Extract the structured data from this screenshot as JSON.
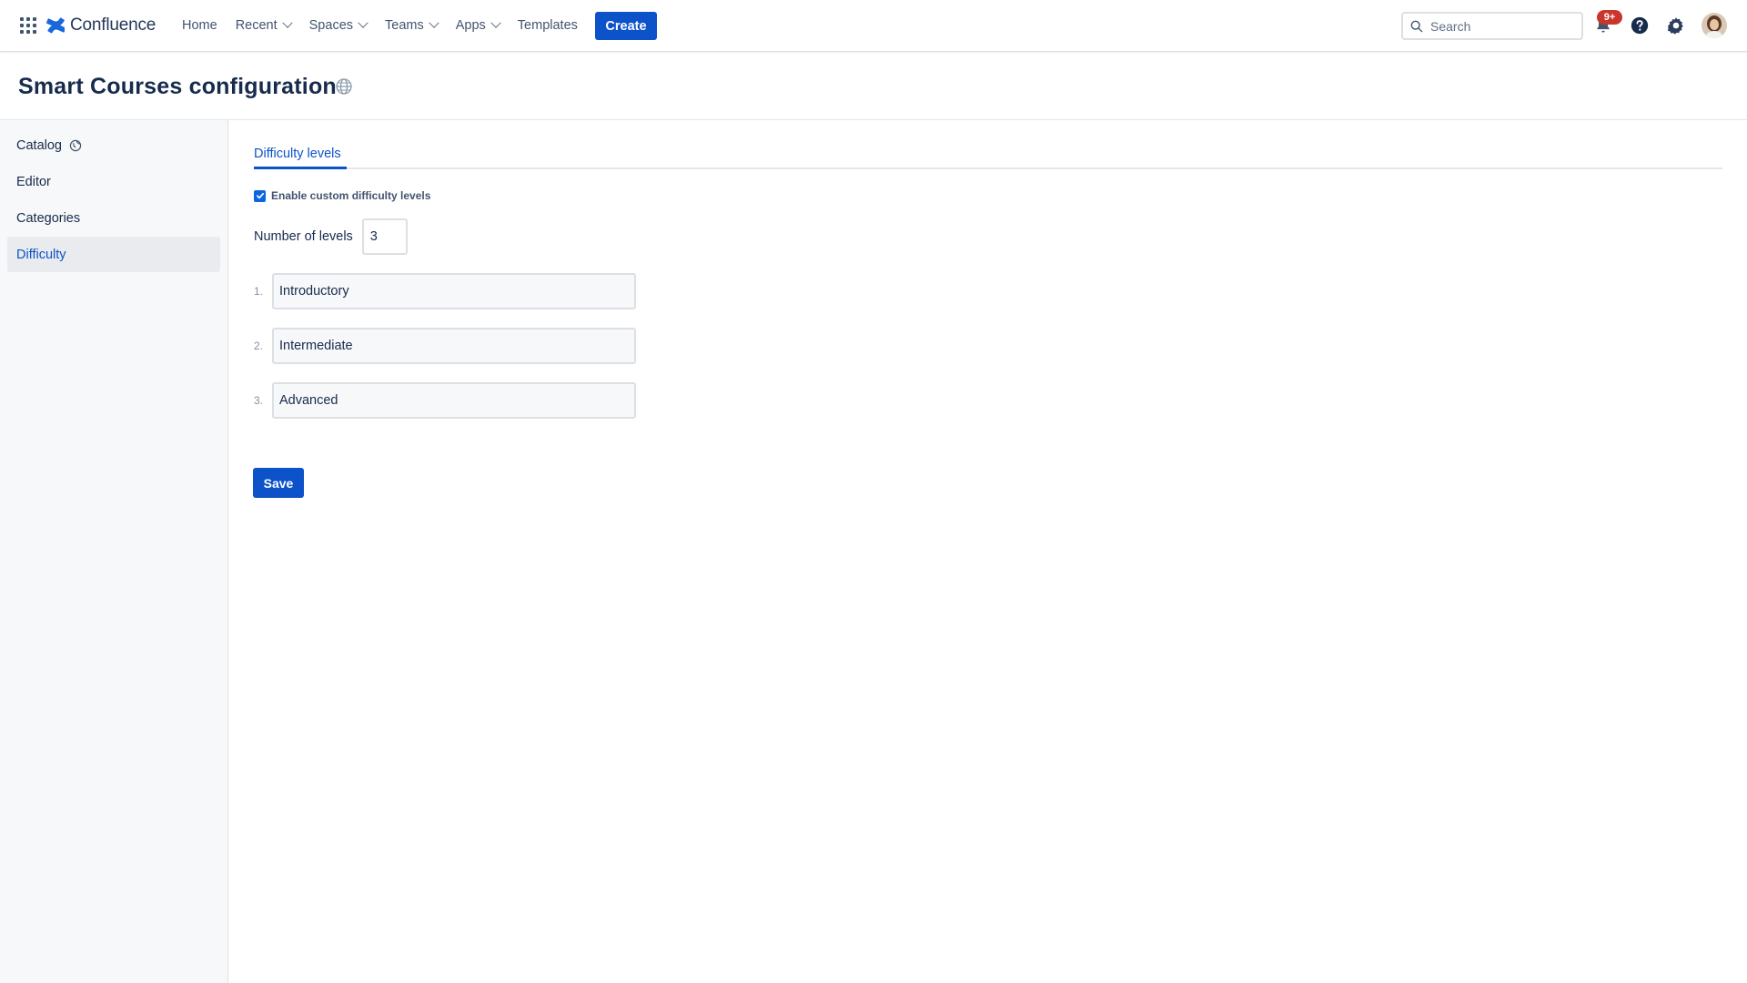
{
  "app": {
    "name": "Confluence"
  },
  "nav": {
    "items": [
      {
        "label": "Home",
        "dropdown": false
      },
      {
        "label": "Recent",
        "dropdown": true
      },
      {
        "label": "Spaces",
        "dropdown": true
      },
      {
        "label": "Teams",
        "dropdown": true
      },
      {
        "label": "Apps",
        "dropdown": true
      },
      {
        "label": "Templates",
        "dropdown": false
      }
    ],
    "create_label": "Create",
    "search_placeholder": "Search",
    "notifications_badge": "9+",
    "accent_color": "#0c52c9",
    "badge_color": "#c9372c"
  },
  "page": {
    "title": "Smart Courses configuration"
  },
  "sidebar": {
    "items": [
      {
        "label": "Catalog",
        "icon": "globe-icon",
        "active": false
      },
      {
        "label": "Editor",
        "active": false
      },
      {
        "label": "Categories",
        "active": false
      },
      {
        "label": "Difficulty",
        "active": true
      }
    ]
  },
  "main": {
    "tab_label": "Difficulty levels",
    "enable_checkbox": {
      "label": "Enable custom difficulty levels",
      "checked": true
    },
    "number_of_levels": {
      "label": "Number of levels",
      "value": "3"
    },
    "levels": [
      {
        "number": "1.",
        "value": "Introductory"
      },
      {
        "number": "2.",
        "value": "Intermediate"
      },
      {
        "number": "3.",
        "value": "Advanced"
      }
    ],
    "save_label": "Save"
  }
}
